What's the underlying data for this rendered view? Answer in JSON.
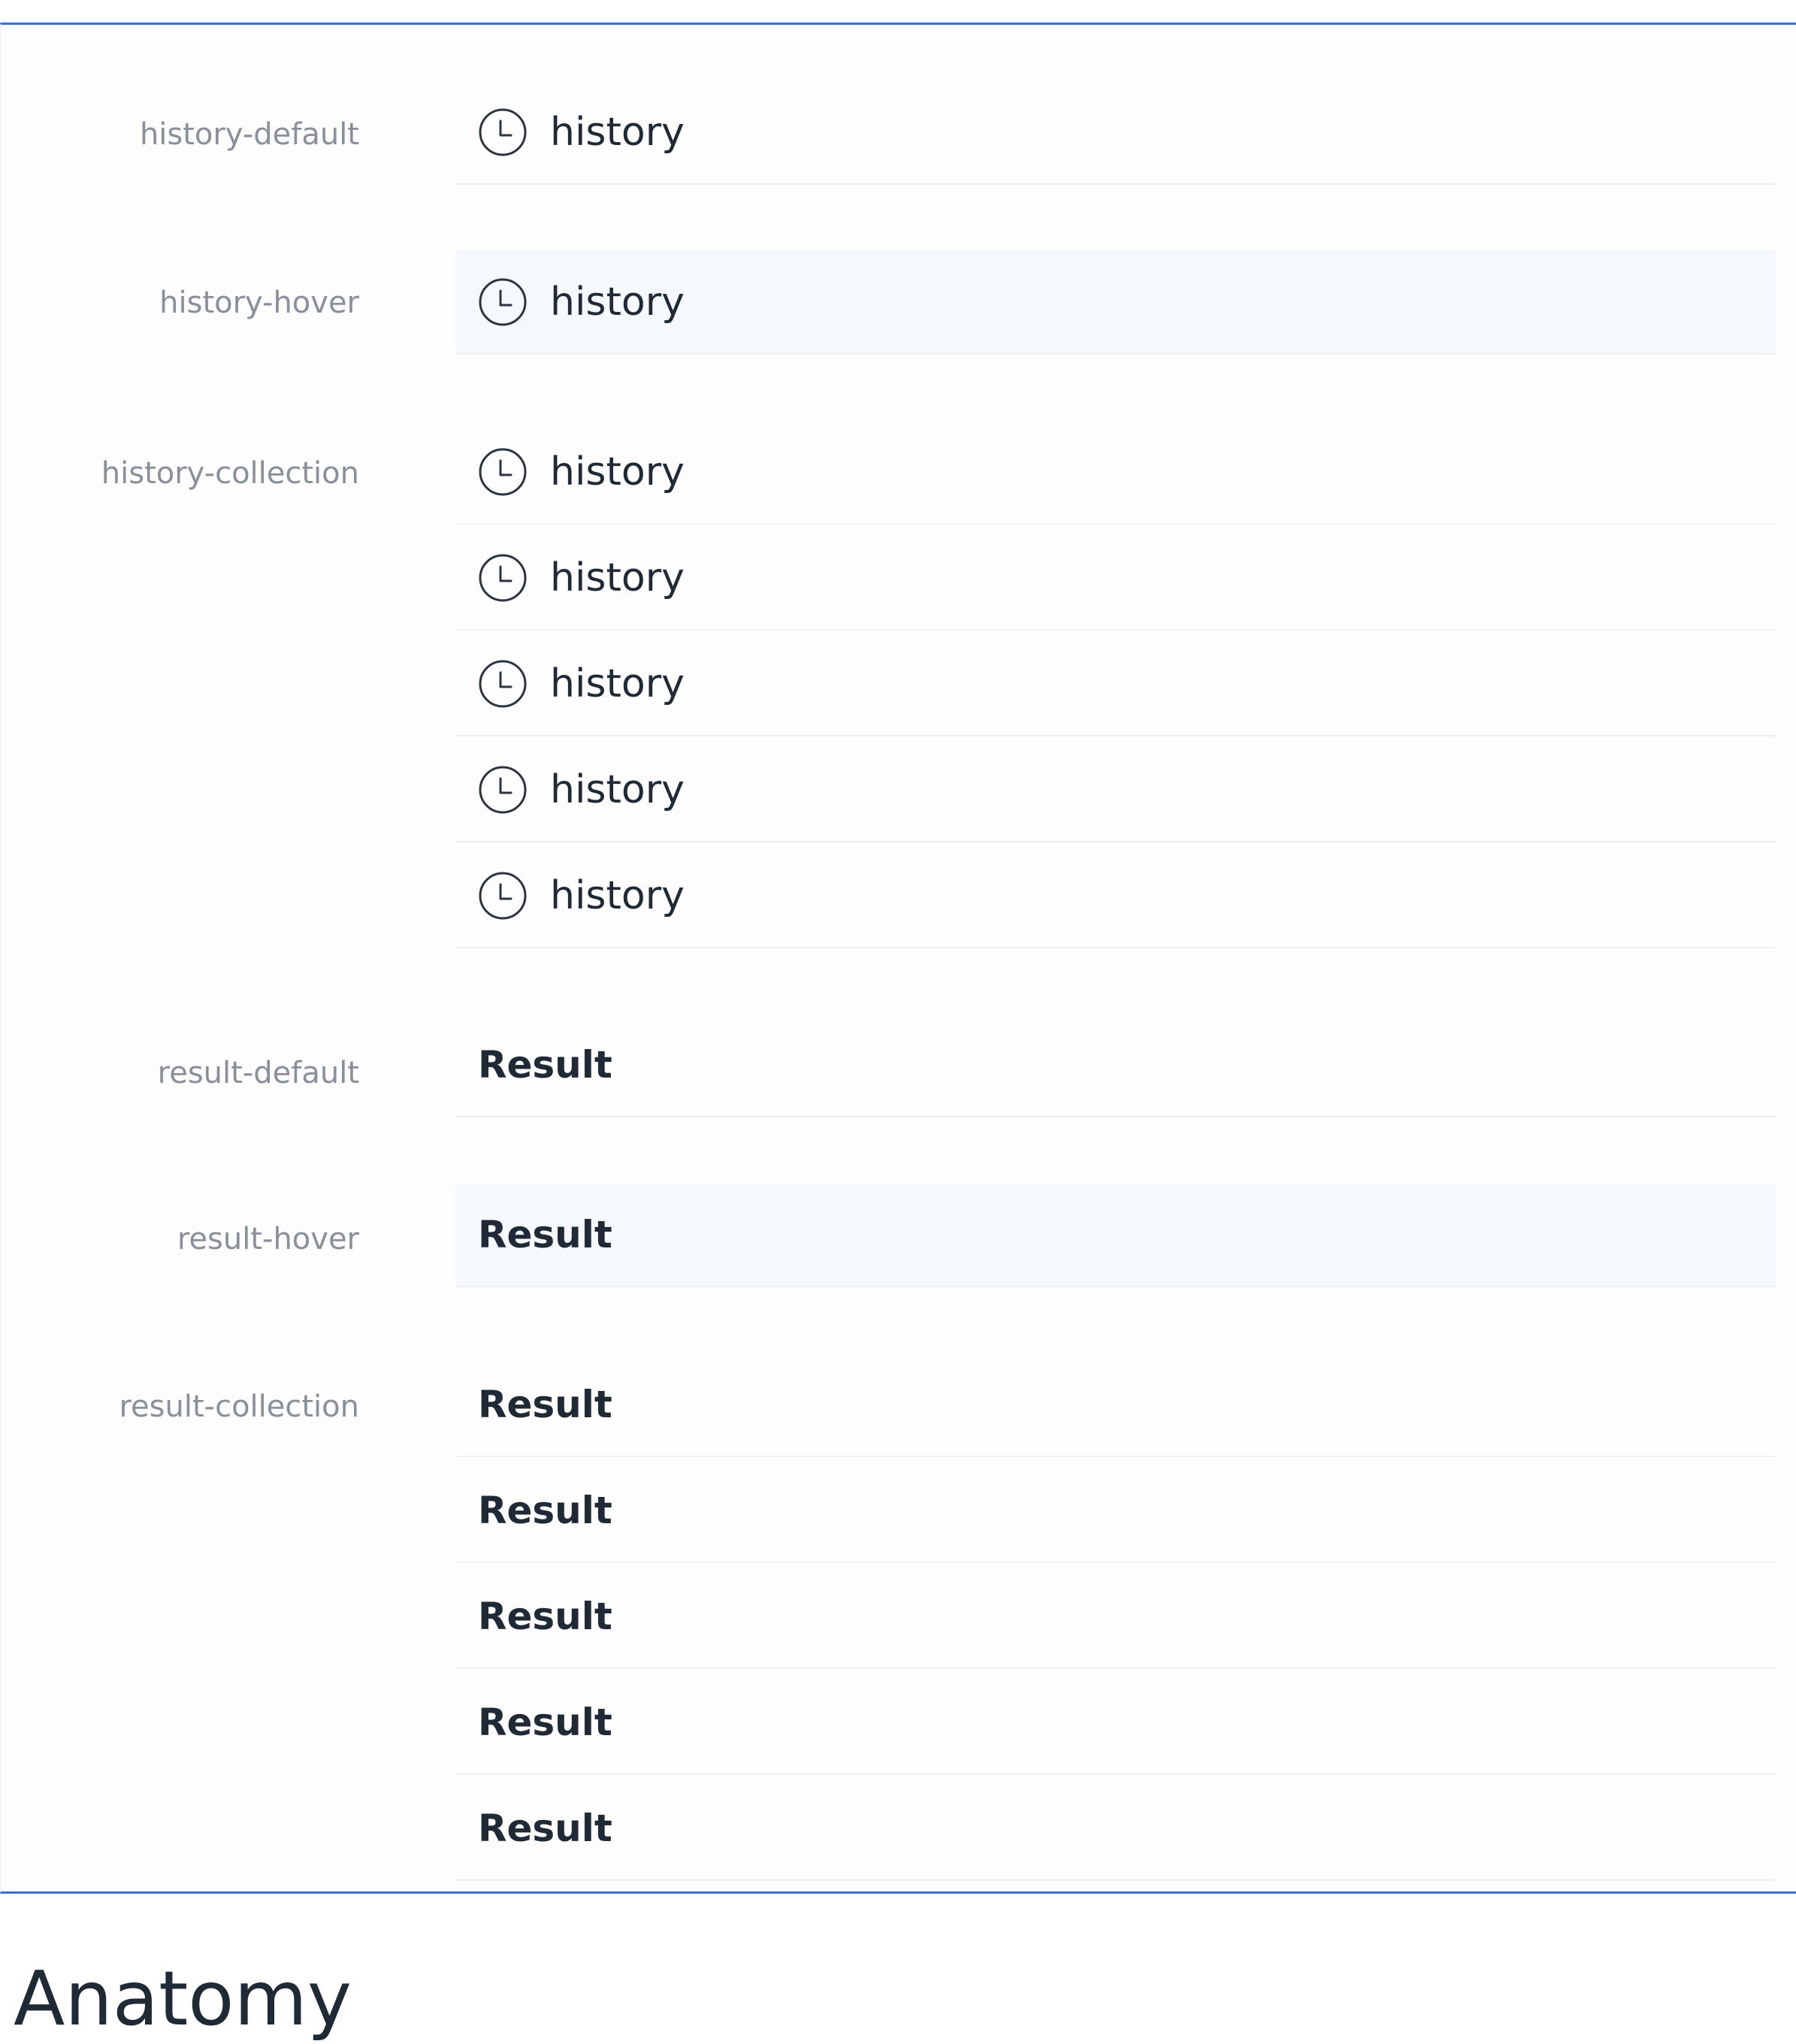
{
  "history_default": {
    "label": "history-default",
    "items": [
      {
        "icon": "clock-icon",
        "text": "history"
      }
    ]
  },
  "history_hover": {
    "label": "history-hover",
    "items": [
      {
        "icon": "clock-icon",
        "text": "history"
      }
    ]
  },
  "history_collection": {
    "label": "history-collection",
    "items": [
      {
        "icon": "clock-icon",
        "text": "history"
      },
      {
        "icon": "clock-icon",
        "text": "history"
      },
      {
        "icon": "clock-icon",
        "text": "history"
      },
      {
        "icon": "clock-icon",
        "text": "history"
      },
      {
        "icon": "clock-icon",
        "text": "history"
      }
    ]
  },
  "result_default": {
    "label": "result-default",
    "items": [
      {
        "text": "Result"
      }
    ]
  },
  "result_hover": {
    "label": "result-hover",
    "items": [
      {
        "text": "Result"
      }
    ]
  },
  "result_collection": {
    "label": "result-collection",
    "items": [
      {
        "text": "Result"
      },
      {
        "text": "Result"
      },
      {
        "text": "Result"
      },
      {
        "text": "Result"
      },
      {
        "text": "Result"
      }
    ]
  },
  "section_heading": "Anatomy",
  "colors": {
    "frame_border": "#3b6fd4",
    "hover_background": "#f5f9fd",
    "label_text": "#8a9099",
    "item_text": "#1f2a36"
  }
}
